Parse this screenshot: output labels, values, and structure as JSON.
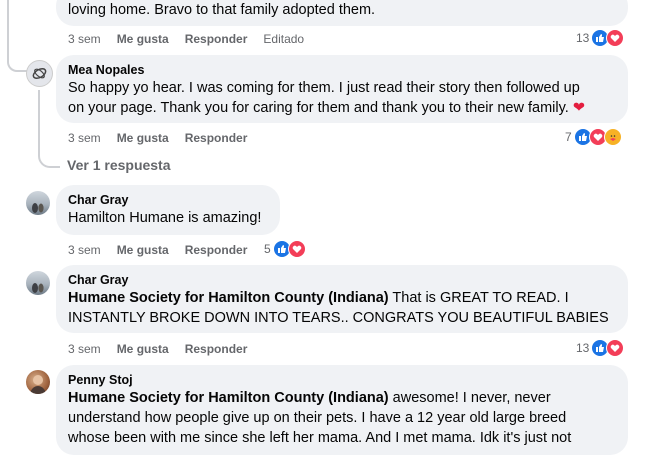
{
  "comments": [
    {
      "text": "loving home. Bravo to that family adopted them.",
      "time": "3 sem",
      "like": "Me gusta",
      "reply": "Responder",
      "edited": "Editado",
      "reactions": "13"
    },
    {
      "author": "Mea Nopales",
      "text1": "So happy yo hear. I was coming for them. I just read their story then followed up",
      "text2": "on your page. Thank you for caring for them and thank you to their new family.",
      "time": "3 sem",
      "like": "Me gusta",
      "reply": "Responder",
      "reactions": "7",
      "view_replies": "Ver 1 respuesta"
    },
    {
      "author": "Char Gray",
      "text": "Hamilton Humane is amazing!",
      "time": "3 sem",
      "like": "Me gusta",
      "reply": "Responder",
      "reactions": "5"
    },
    {
      "author": "Char Gray",
      "mention": "Humane Society for Hamilton County (Indiana)",
      "text1": "That is GREAT TO READ. I",
      "text2": "INSTANTLY BROKE DOWN INTO TEARS.. CONGRATS YOU BEAUTIFUL BABIES",
      "time": "3 sem",
      "like": "Me gusta",
      "reply": "Responder",
      "reactions": "13"
    },
    {
      "author": "Penny Stoj",
      "mention": "Humane Society for Hamilton County (Indiana)",
      "text1": "awesome! I never, never",
      "text2": "understand how people give up on their pets. I have a 12 year old large breed",
      "text3": "whose been with me since she left her mama. And I met mama. Idk it's just not"
    }
  ],
  "icons": {
    "like": "thumbs-up-icon",
    "love": "heart-icon",
    "care": "care-face-icon",
    "emoji": "red-heart-emoji"
  },
  "colors": {
    "like": "#1b74e4",
    "love": "#f33e58",
    "care": "#f7b125",
    "bubble": "#f0f2f5",
    "meta": "#65676b"
  }
}
